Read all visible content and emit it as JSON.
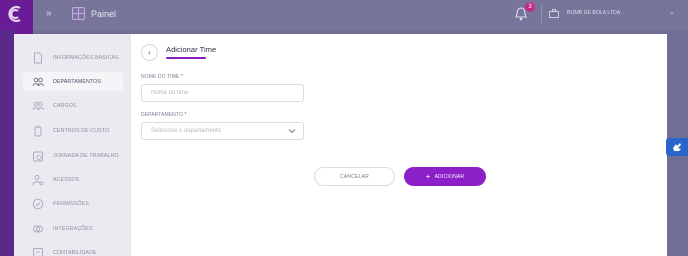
{
  "topbar": {
    "collapse_icon": "»",
    "title": "Painel",
    "notifications_count": "3",
    "company": "BOMB DE BOLA LTDA.",
    "chevron": "⌄"
  },
  "nav": {
    "items": [
      {
        "label": "INFORMAÇÕES BÁSICAS",
        "icon": "document-icon",
        "active": false
      },
      {
        "label": "DEPARTAMENTOS",
        "icon": "people-icon",
        "active": true
      },
      {
        "label": "CARGOS",
        "icon": "group-icon",
        "active": false
      },
      {
        "label": "CENTROS DE CUSTO",
        "icon": "wallet-icon",
        "active": false
      },
      {
        "label": "JORNADA DE TRABALHO",
        "icon": "calendar-icon",
        "active": false
      },
      {
        "label": "ACESSOS",
        "icon": "user-access-icon",
        "active": false
      },
      {
        "label": "PERMISSÕES",
        "icon": "check-shield-icon",
        "active": false
      },
      {
        "label": "INTEGRAÇÕES",
        "icon": "integration-icon",
        "active": false
      },
      {
        "label": "CONTABILIDADE",
        "icon": "accounting-icon",
        "active": false
      }
    ]
  },
  "form": {
    "back": "‹",
    "title": "Adicionar Time",
    "name_label": "NOME DO TIME",
    "required_mark": "*",
    "name_placeholder": "Nome do time",
    "department_label": "DEPARTAMENTO",
    "department_placeholder": "Selecione o departamento",
    "cancel_label": "CANCELAR",
    "add_plus": "+",
    "add_label": "ADICIONAR"
  },
  "colors": {
    "accent": "#8b1fc8",
    "rail": "#6a1c96",
    "required": "#d12b6a"
  }
}
